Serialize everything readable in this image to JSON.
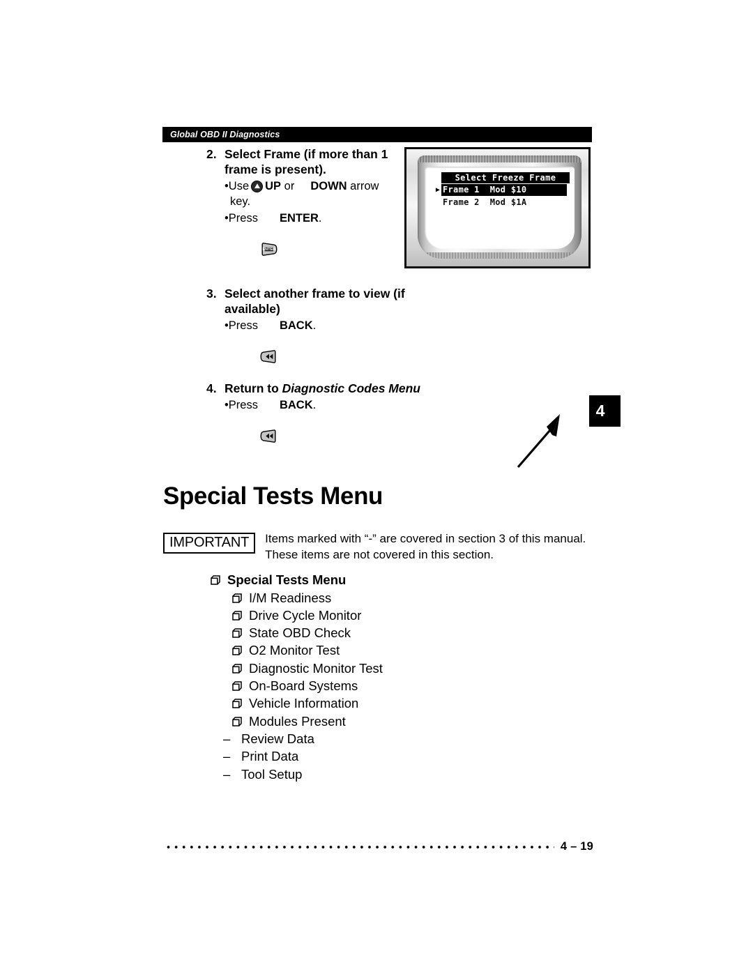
{
  "header": {
    "running_head": "Global OBD II Diagnostics"
  },
  "steps": [
    {
      "number": "2.",
      "title": "Select Frame (if more than 1 frame is present).",
      "bullets": [
        {
          "lead": "•Use",
          "icon1": "up-arrow-key-icon",
          "kw1": "UP",
          "mid": "or",
          "icon2": "down-arrow-key-icon",
          "kw2": "DOWN",
          "tail": "arrow",
          "second_line": "key."
        },
        {
          "lead": "•Press",
          "icon1": "enter-key-icon",
          "kw1": "ENTER",
          "tail": "."
        }
      ]
    },
    {
      "number": "3.",
      "title": "Select another frame to view (if available)",
      "bullets": [
        {
          "lead": "•Press",
          "icon1": "back-key-icon",
          "kw1": "BACK",
          "tail": "."
        }
      ]
    },
    {
      "number": "4.",
      "title_plain": "Return to ",
      "title_italic": "Diagnostic Codes Menu",
      "bullets": [
        {
          "lead": "•Press",
          "icon1": "back-key-icon",
          "kw1": "BACK",
          "tail": "."
        }
      ]
    }
  ],
  "device_screen": {
    "title": "Select Freeze Frame",
    "cursor_glyph": "▶",
    "rows": [
      {
        "text": "Frame 1  Mod $10",
        "selected": true
      },
      {
        "text": "Frame 2  Mod $1A",
        "selected": false
      }
    ]
  },
  "chapter_tab": {
    "number": "4"
  },
  "section": {
    "title": "Special Tests Menu"
  },
  "important": {
    "label": "IMPORTANT",
    "text": "Items marked with “-” are covered in section 3 of this manual. These items are not covered in this section."
  },
  "tests_list": [
    {
      "label": "Special Tests Menu",
      "level": 0,
      "marker": "box"
    },
    {
      "label": "I/M Readiness",
      "level": 1,
      "marker": "box"
    },
    {
      "label": "Drive Cycle Monitor",
      "level": 1,
      "marker": "box"
    },
    {
      "label": "State OBD Check",
      "level": 1,
      "marker": "box"
    },
    {
      "label": "O2 Monitor Test",
      "level": 1,
      "marker": "box"
    },
    {
      "label": "Diagnostic Monitor Test",
      "level": 1,
      "marker": "box"
    },
    {
      "label": "On-Board Systems",
      "level": 1,
      "marker": "box"
    },
    {
      "label": "Vehicle Information",
      "level": 1,
      "marker": "box"
    },
    {
      "label": "Modules Present",
      "level": 1,
      "marker": "box"
    },
    {
      "label": "Review Data",
      "level": 1,
      "marker": "dash",
      "dash": "–"
    },
    {
      "label": "Print Data",
      "level": 1,
      "marker": "dash",
      "dash": "–"
    },
    {
      "label": "Tool Setup",
      "level": 1,
      "marker": "dash",
      "dash": "–"
    }
  ],
  "footer": {
    "page_number": "4 – 19"
  }
}
